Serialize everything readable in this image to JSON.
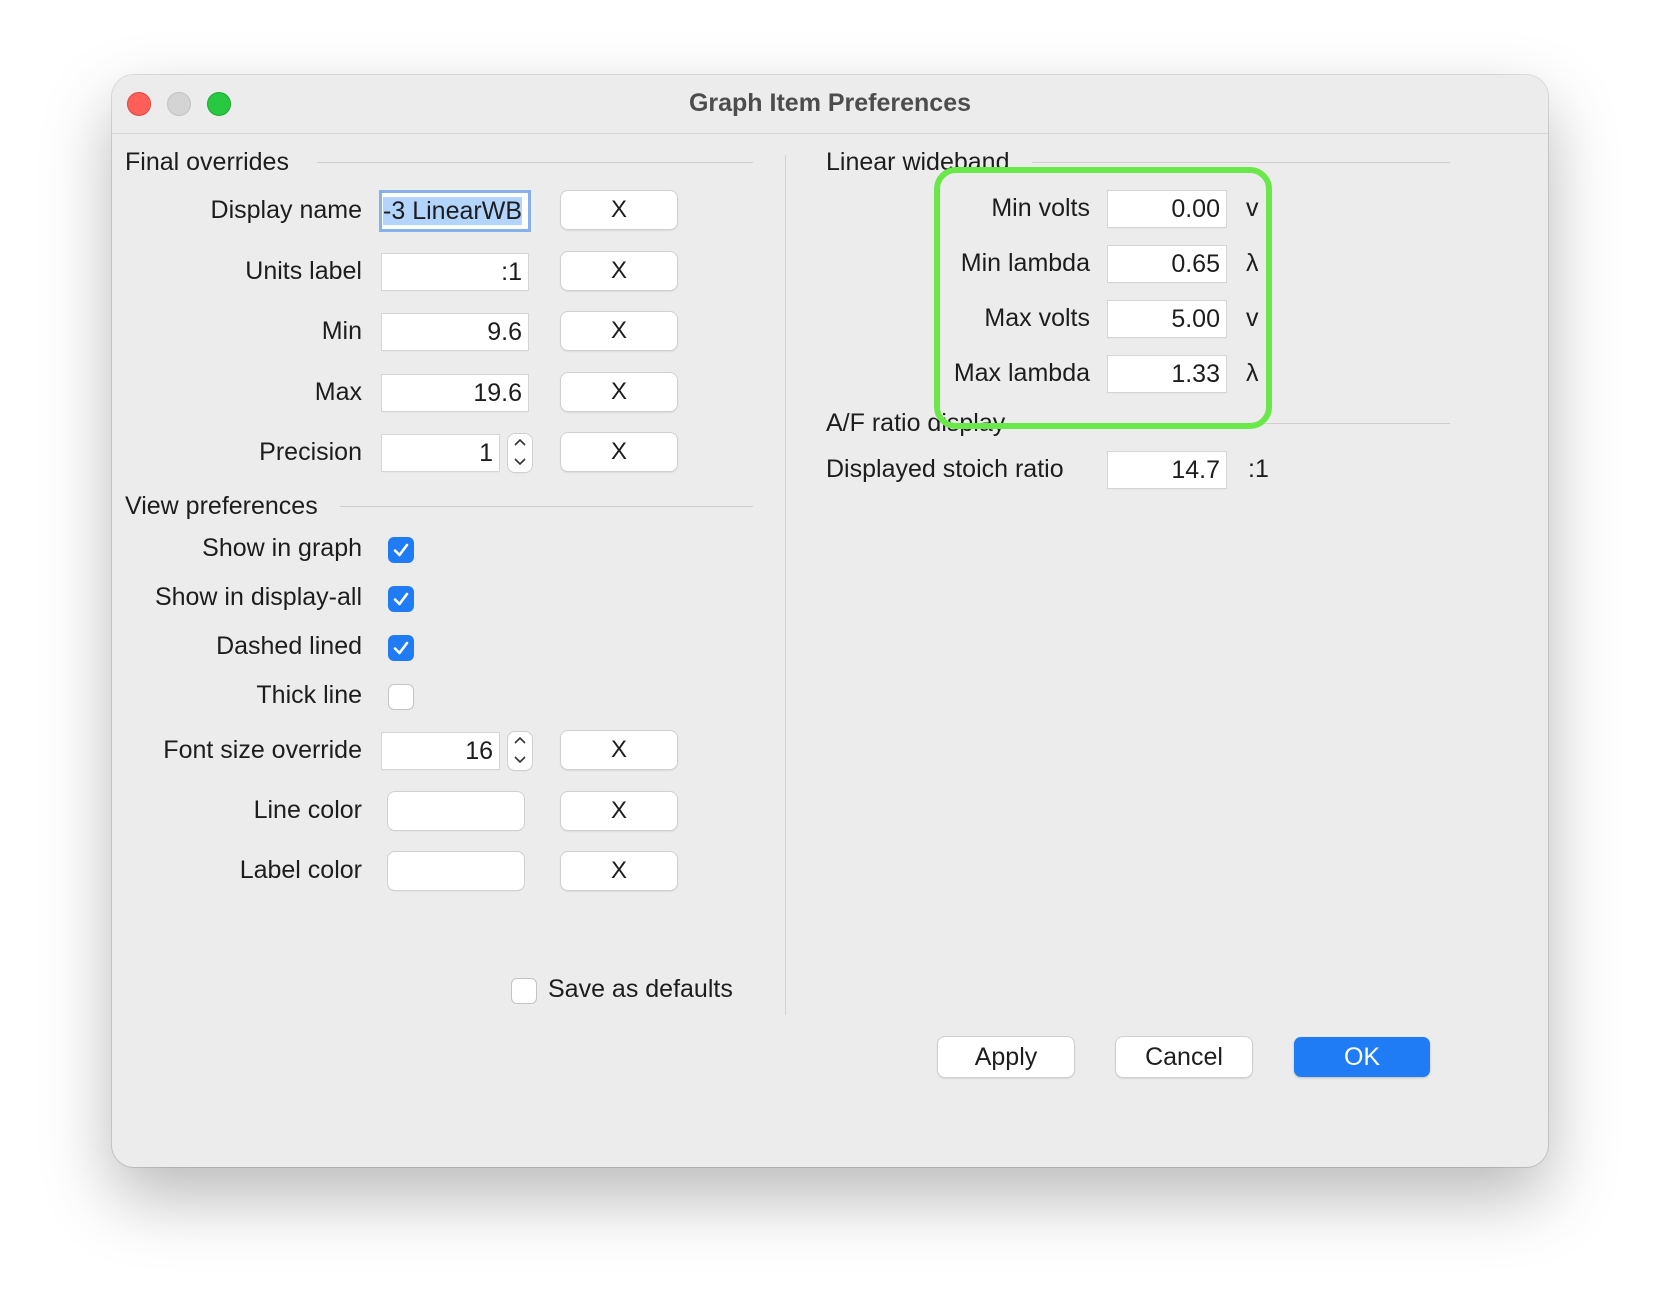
{
  "window": {
    "title": "Graph Item Preferences"
  },
  "final_overrides": {
    "heading": "Final overrides",
    "display_name": {
      "label": "Display name",
      "value": "-3 LinearWB",
      "clear": "X"
    },
    "units_label": {
      "label": "Units label",
      "value": ":1",
      "clear": "X"
    },
    "min": {
      "label": "Min",
      "value": "9.6",
      "clear": "X"
    },
    "max": {
      "label": "Max",
      "value": "19.6",
      "clear": "X"
    },
    "precision": {
      "label": "Precision",
      "value": "1",
      "clear": "X"
    }
  },
  "view_preferences": {
    "heading": "View preferences",
    "show_in_graph": {
      "label": "Show in graph",
      "checked": true
    },
    "show_in_display_all": {
      "label": "Show in display-all",
      "checked": true
    },
    "dashed_lined": {
      "label": "Dashed lined",
      "checked": true
    },
    "thick_line": {
      "label": "Thick line",
      "checked": false
    },
    "font_size_override": {
      "label": "Font size override",
      "value": "16",
      "clear": "X"
    },
    "line_color": {
      "label": "Line color",
      "clear": "X"
    },
    "label_color": {
      "label": "Label color",
      "clear": "X"
    }
  },
  "save_as_defaults": {
    "label": "Save as defaults",
    "checked": false
  },
  "linear_wideband": {
    "heading": "Linear wideband",
    "min_volts": {
      "label": "Min volts",
      "value": "0.00",
      "unit": "v"
    },
    "min_lambda": {
      "label": "Min lambda",
      "value": "0.65",
      "unit": "λ"
    },
    "max_volts": {
      "label": "Max volts",
      "value": "5.00",
      "unit": "v"
    },
    "max_lambda": {
      "label": "Max lambda",
      "value": "1.33",
      "unit": "λ"
    }
  },
  "af_ratio_display": {
    "heading": "A/F ratio display",
    "displayed_stoich_ratio": {
      "label": "Displayed stoich ratio",
      "value": "14.7",
      "unit": ":1"
    }
  },
  "buttons": {
    "apply": "Apply",
    "cancel": "Cancel",
    "ok": "OK"
  },
  "colors": {
    "accent": "#1f7cf5",
    "highlight": "#6ae84a",
    "close": "#ff5f57",
    "zoom": "#28c840"
  }
}
